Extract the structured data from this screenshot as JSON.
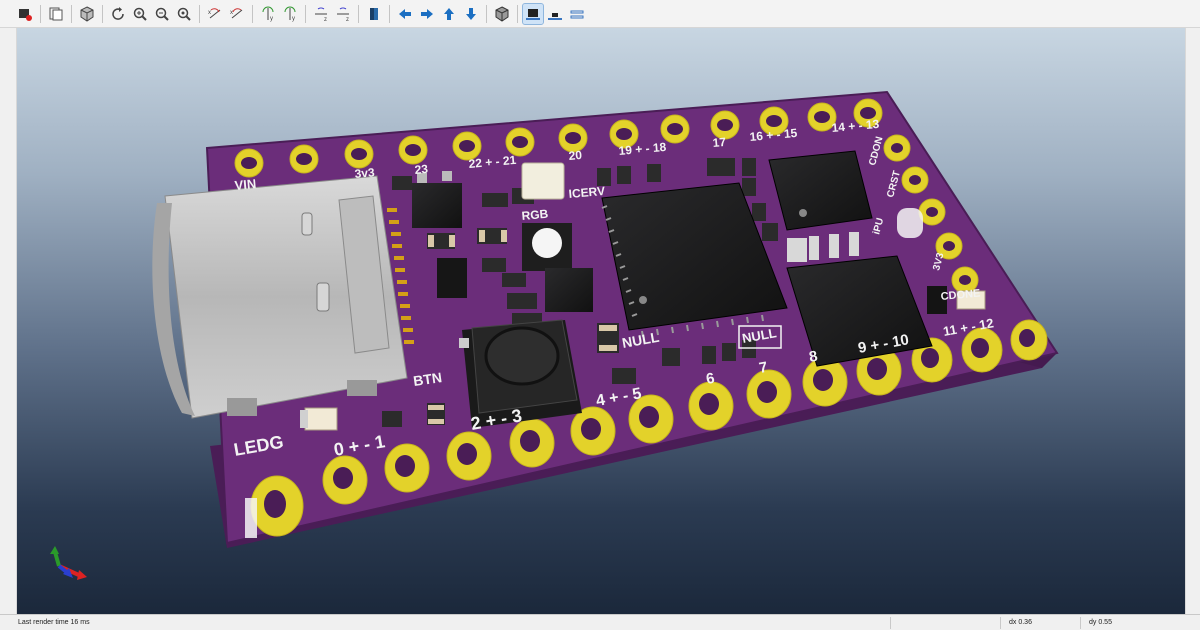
{
  "toolbar": {
    "buttons": [
      {
        "icon": "render-icon"
      },
      {
        "icon": "copy-image-icon"
      },
      {
        "icon": "3d-model-icon"
      },
      {
        "icon": "reload-icon"
      },
      {
        "icon": "zoom-in-icon"
      },
      {
        "icon": "zoom-out-icon"
      },
      {
        "icon": "zoom-fit-icon"
      },
      {
        "icon": "rotate-x-cw-icon"
      },
      {
        "icon": "rotate-x-ccw-icon"
      },
      {
        "icon": "rotate-y-cw-icon"
      },
      {
        "icon": "rotate-y-ccw-icon"
      },
      {
        "icon": "rotate-z-cw-icon"
      },
      {
        "icon": "rotate-z-ccw-icon"
      },
      {
        "icon": "flip-board-icon"
      },
      {
        "icon": "move-left-icon"
      },
      {
        "icon": "move-right-icon"
      },
      {
        "icon": "move-up-icon"
      },
      {
        "icon": "move-down-icon"
      },
      {
        "icon": "ortho-icon"
      },
      {
        "icon": "view-front-icon"
      },
      {
        "icon": "view-bottom-icon"
      },
      {
        "icon": "view-layers-icon"
      }
    ]
  },
  "board": {
    "silkscreen": {
      "vin": "VIN",
      "v33": "3v3",
      "p23": "23",
      "p22_21": "22 + - 21",
      "p20": "20",
      "p19_18": "19 + - 18",
      "p17": "17",
      "p16_15": "16 + - 15",
      "p14_13": "14 + - 13",
      "cdon": "CDON",
      "crst": "CRST",
      "icerv": "ICERV",
      "rgb": "RGB",
      "null1": "NULL",
      "null2": "NULL",
      "btn": "BTN",
      "ledg": "LEDG",
      "p0_1": "0 + - 1",
      "p2_3": "2 + - 3",
      "p4_5": "4 + - 5",
      "p6": "6",
      "p7": "7",
      "p8": "8",
      "p9_10": "9 + - 10",
      "p11_12": "11 + - 12",
      "cdone": "CDONE",
      "v33b": "3V3",
      "ipu": "iPU"
    }
  },
  "status": {
    "message": "Last render time 16 ms",
    "dx": "dx 0.36",
    "dy": "dy 0.55"
  },
  "colors": {
    "pcb": "#6b2d7a",
    "pcb_dark": "#4a1d56",
    "gold": "#e3d22a",
    "chip": "#1c1c1e",
    "usb": "#c8c8c8"
  }
}
